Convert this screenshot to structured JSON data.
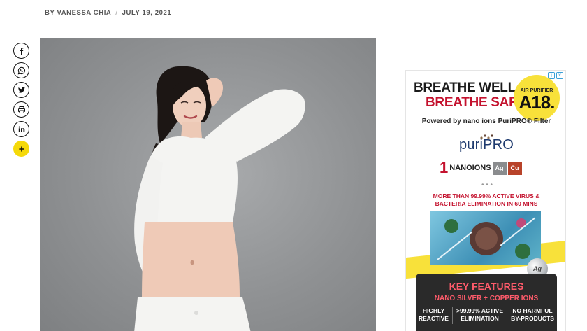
{
  "article": {
    "byline_author": "BY VANESSA CHIA",
    "byline_separator": "/",
    "byline_date": "JULY 19, 2021"
  },
  "share": {
    "buttons": [
      {
        "name": "facebook-icon"
      },
      {
        "name": "whatsapp-icon"
      },
      {
        "name": "twitter-icon"
      },
      {
        "name": "print-icon"
      },
      {
        "name": "linkedin-icon"
      },
      {
        "name": "plus-icon"
      }
    ],
    "more_color": "#f5d90a"
  },
  "ad": {
    "headline_1": "BREATHE WELL",
    "headline_2": "BREATHE SAFE",
    "badge_small": "AIR PURIFIER",
    "badge_big": "A18.",
    "powered_by": "Powered by nano ions PuriPRO® Filter",
    "brand": "puriPRO",
    "nano_number": "1",
    "nano_label": "NANOIONS",
    "element_ag": "Ag",
    "element_cu": "Cu",
    "claim_line_1": "MORE THAN 99.99% ACTIVE VIRUS &",
    "claim_line_2": "BACTERIA ELIMINATION IN 60 MINS",
    "ag_ball": "Ag",
    "key_title": "KEY FEATURES",
    "key_subtitle": "NANO SILVER + COPPER IONS",
    "features": [
      {
        "line1": "HIGHLY",
        "line2": "REACTIVE"
      },
      {
        "line1": ">99.99% ACTIVE",
        "line2": "ELIMINATION"
      },
      {
        "line1": "NO HARMFUL",
        "line2": "BY-PRODUCTS"
      }
    ],
    "colors": {
      "red": "#c4122e",
      "yellow": "#f8e13a",
      "navy": "#1e3a6e"
    }
  }
}
